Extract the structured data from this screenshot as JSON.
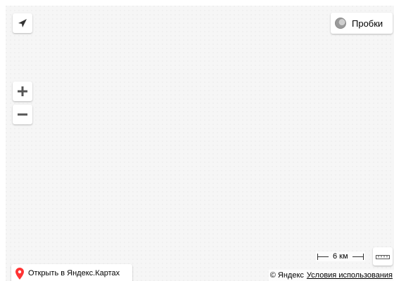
{
  "map": {
    "background_color": "#f6f6f6"
  },
  "controls": {
    "geolocation": {
      "icon": "geolocation-arrow-icon"
    },
    "zoom_in": {
      "icon": "plus-icon"
    },
    "zoom_out": {
      "icon": "minus-icon"
    },
    "traffic": {
      "label": "Пробки",
      "icon": "traffic-light-icon"
    },
    "ruler": {
      "icon": "ruler-icon"
    }
  },
  "scale": {
    "label": "6 км"
  },
  "open_link": {
    "label": "Открыть в Яндекс.Картах",
    "icon": "map-pin-icon",
    "pin_color": "#ff3333"
  },
  "footer": {
    "copyright": "© Яндекс",
    "terms": "Условия использования"
  }
}
